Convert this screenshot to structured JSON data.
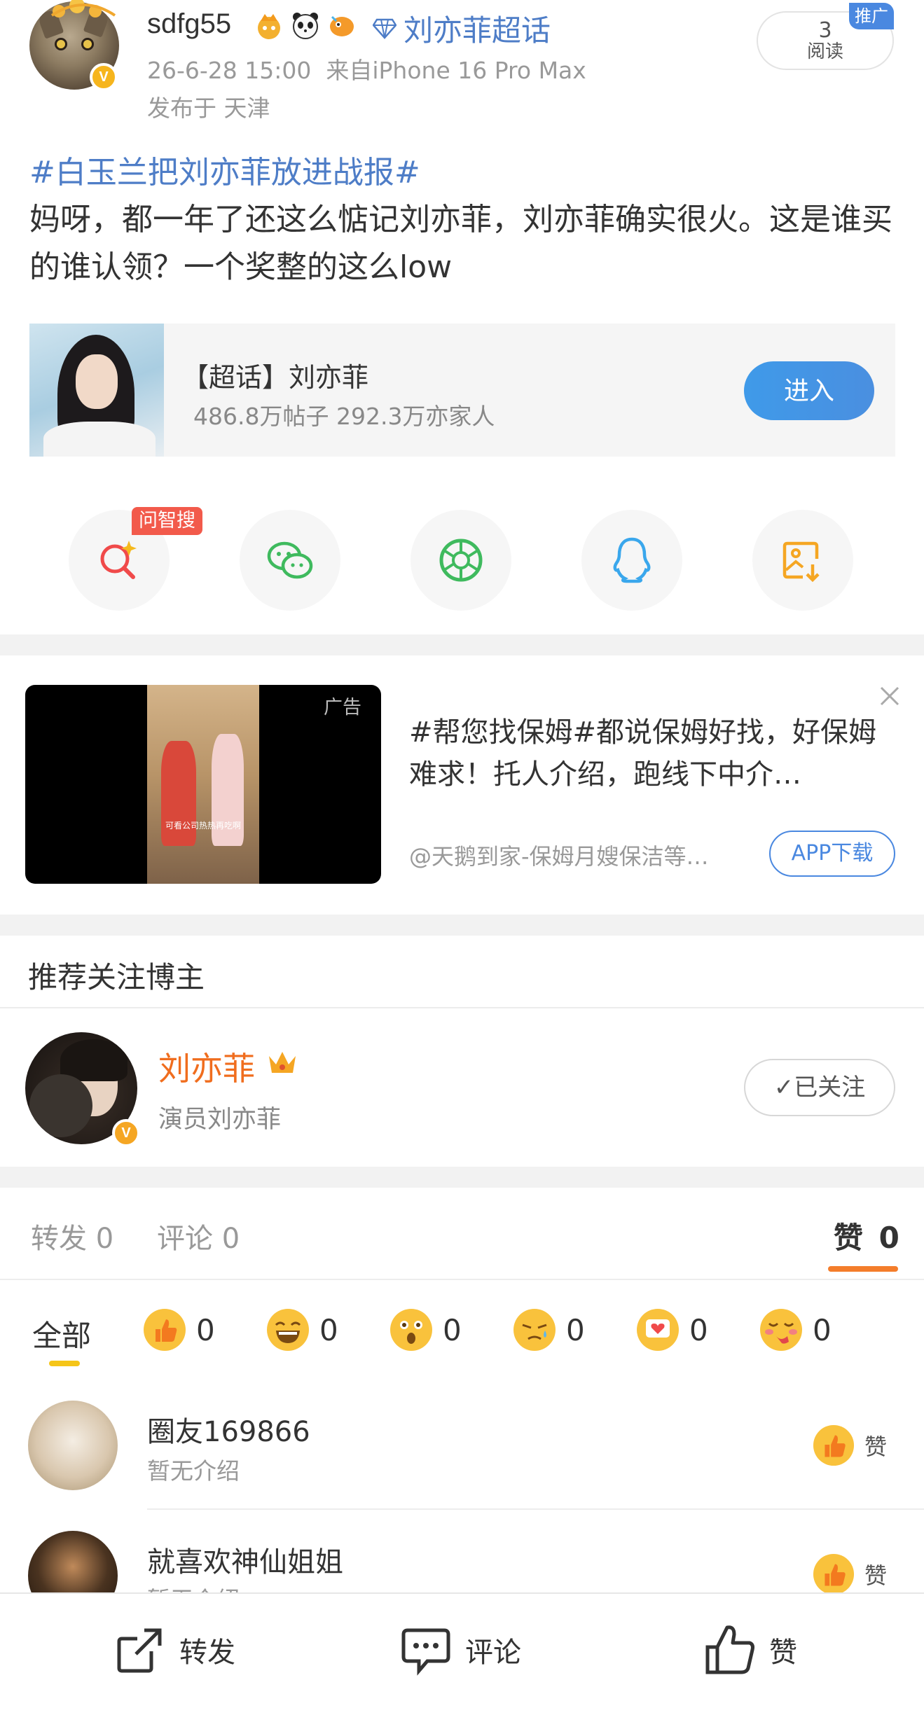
{
  "post": {
    "username": "sdfg55",
    "badges": [
      "crown-badge-icon",
      "panda-badge-icon",
      "fish-badge-icon"
    ],
    "topic_link": "刘亦菲超话",
    "time_source": "26-6-28 15:00  来自iPhone 16 Pro Max",
    "location": "发布于 天津",
    "read_count": "3",
    "read_label": "阅读",
    "promo_tag": "推广",
    "hashtag": "#白玉兰把刘亦菲放进战报#",
    "body": "妈呀，都一年了还这么惦记刘亦菲，刘亦菲确实很火。这是谁买的谁认领？一个奖整的这么low"
  },
  "supertopic_card": {
    "title": "【超话】刘亦菲",
    "subtitle": "486.8万帖子 292.3万亦家人",
    "enter_label": "进入"
  },
  "share": {
    "ai_tag": "问智搜",
    "icons": [
      "ai-search-icon",
      "wechat-icon",
      "moments-icon",
      "qq-icon",
      "save-image-icon"
    ]
  },
  "ad": {
    "tag": "广告",
    "caption": "可看公司热热再吃啊",
    "text": "#帮您找保姆#都说保姆好找，好保姆难求！托人介绍，跑线下中介…",
    "source": "@天鹅到家-保姆月嫂保洁等…",
    "button": "APP下载"
  },
  "recommend": {
    "title": "推荐关注博主",
    "name": "刘亦菲",
    "desc": "演员刘亦菲",
    "follow_label": "✓已关注"
  },
  "tabs": {
    "repost": "转发 0",
    "comment": "评论 0",
    "like_label": "赞",
    "like_count": "0"
  },
  "reactions": {
    "all_label": "全部",
    "items": [
      {
        "icon": "thumbs-up-reaction-icon",
        "count": "0"
      },
      {
        "icon": "laugh-reaction-icon",
        "count": "0"
      },
      {
        "icon": "surprised-reaction-icon",
        "count": "0"
      },
      {
        "icon": "sad-reaction-icon",
        "count": "0"
      },
      {
        "icon": "heart-reaction-icon",
        "count": "0"
      },
      {
        "icon": "blush-reaction-icon",
        "count": "0"
      }
    ]
  },
  "likers": [
    {
      "name": "圈友169866",
      "intro": "暂无介绍",
      "like_label": "赞"
    },
    {
      "name": "就喜欢神仙姐姐",
      "intro": "暂无介绍",
      "like_label": "赞"
    }
  ],
  "bottom_bar": {
    "repost": "转发",
    "comment": "评论",
    "like": "赞"
  },
  "colors": {
    "link_blue": "#4e7dc7",
    "accent_orange": "#f47d2b",
    "button_blue": "#4a88e0"
  }
}
